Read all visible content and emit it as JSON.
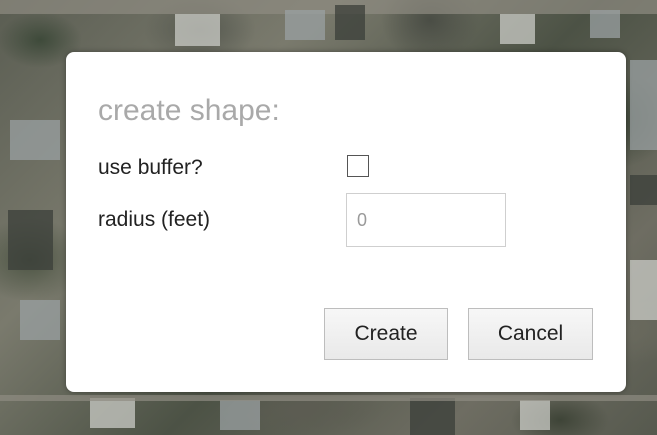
{
  "dialog": {
    "title": "create shape:",
    "use_buffer_label": "use buffer?",
    "use_buffer_checked": false,
    "radius_label": "radius (feet)",
    "radius_value": "0",
    "create_label": "Create",
    "cancel_label": "Cancel"
  },
  "map": {
    "background": "aerial-imagery"
  }
}
